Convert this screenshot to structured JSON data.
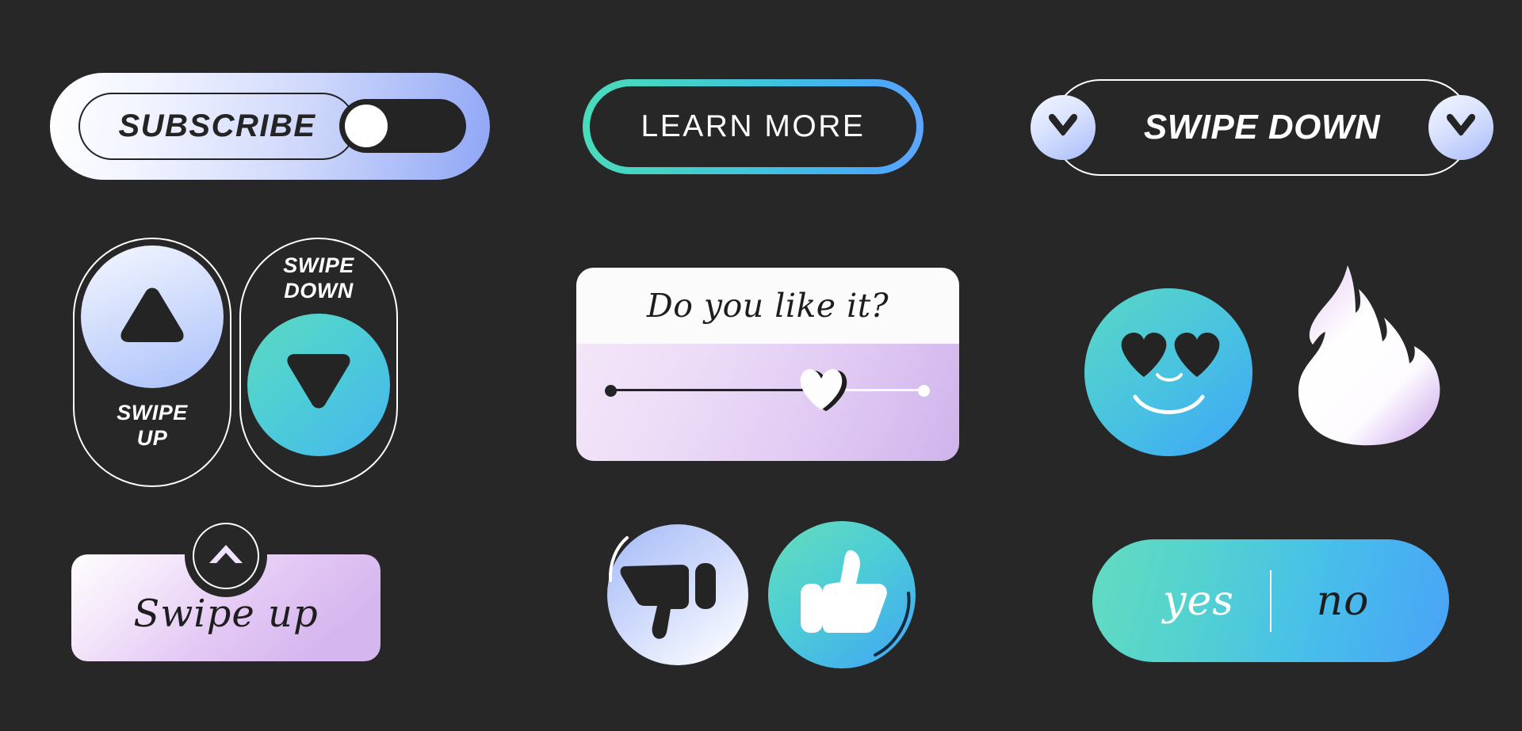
{
  "background_color": "#272727",
  "subscribe": {
    "label": "SUBSCRIBE",
    "toggle_state": "on",
    "track_color": "#242424",
    "knob_color": "#ffffff",
    "gradient_from": "#ffffff",
    "gradient_to": "#8fa6f6"
  },
  "learn_more": {
    "label": "LEARN MORE",
    "border_gradient_from": "#49dcbb",
    "border_gradient_to": "#5fa6ff",
    "face_color": "#272727"
  },
  "swipe_down_bar": {
    "label": "SWIPE DOWN",
    "left_icon": "chevron-down-icon",
    "right_icon": "chevron-down-icon",
    "outline_color": "#ffffff",
    "badge_gradient_from": "#f3f6ff",
    "badge_gradient_to": "#a8bcfb"
  },
  "swipe_up_capsule": {
    "label": "SWIPE\nUP",
    "label_line1": "SWIPE",
    "label_line2": "UP",
    "icon": "triangle-up-icon",
    "circle_gradient_from": "#f4f7ff",
    "circle_gradient_to": "#a9c0fa"
  },
  "swipe_down_capsule": {
    "label_line1": "SWIPE",
    "label_line2": "DOWN",
    "icon": "triangle-down-icon",
    "circle_gradient_from": "#5ed9c0",
    "circle_gradient_to": "#45b6ef"
  },
  "like_card": {
    "title": "Do you like it?",
    "header_color": "#fbfbfb",
    "body_gradient_from": "#f4e6f8",
    "body_gradient_to": "#cfb3ec",
    "slider": {
      "thumb_icon": "heart-icon",
      "value_percent": 62,
      "filled_color": "#242424",
      "rest_color": "#fdfdfd",
      "start_dot_color": "#242424",
      "end_dot_color": "#ffffff"
    }
  },
  "heart_eyes_emoji": {
    "icon": "heart-eyes-emoji",
    "gradient_from": "#5ad8c4",
    "gradient_to": "#3fa9f5",
    "feature_color": "#242424"
  },
  "flame": {
    "icon": "flame-icon",
    "gradient_from": "#ffffff",
    "gradient_to": "#d9b9ef"
  },
  "swipe_up_banner": {
    "label": "Swipe up",
    "icon": "chevron-up-icon",
    "gradient_from": "#ffffff",
    "gradient_to": "#d6b6ef",
    "badge_border_color": "#ffffff"
  },
  "thumbs_down": {
    "icon": "thumbs-down-icon",
    "gradient_from": "#8fa7f5",
    "gradient_to": "#ffffff",
    "thumb_color": "#242424",
    "arc_color": "#ffffff"
  },
  "thumbs_up": {
    "icon": "thumbs-up-icon",
    "gradient_from": "#5ed9c0",
    "gradient_to": "#45b0f0",
    "thumb_color": "#ffffff",
    "arc_color": "#1b2b3a"
  },
  "yes_no": {
    "yes_label": "yes",
    "no_label": "no",
    "yes_color": "#ffffff",
    "no_color": "#1d1d1d",
    "gradient_from": "#64dcc0",
    "gradient_to": "#4aa3f7",
    "divider_color": "#ffffff"
  }
}
